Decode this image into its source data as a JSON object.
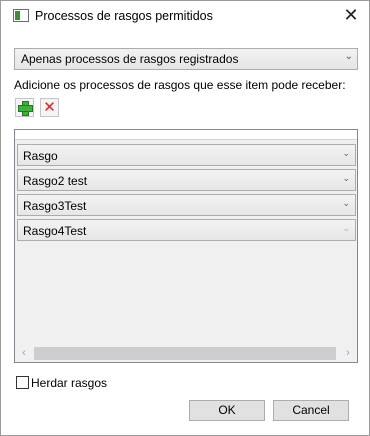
{
  "dialog": {
    "title": "Processos de rasgos permitidos",
    "close_glyph": "✕"
  },
  "mode_select": {
    "selected": "Apenas processos de rasgos registrados"
  },
  "instruction": "Adicione os processos de rasgos que esse item pode receber:",
  "toolbar": {
    "add_icon": "green-plus-icon",
    "remove_icon": "red-x-icon",
    "remove_glyph": "✕"
  },
  "processes": [
    {
      "value": "Rasgo"
    },
    {
      "value": "Rasgo2 test"
    },
    {
      "value": "Rasgo3Test"
    },
    {
      "value": "Rasgo4Test"
    }
  ],
  "scrollbar": {
    "left_glyph": "‹",
    "right_glyph": "›"
  },
  "inherit": {
    "label": "Herdar rasgos",
    "checked": false
  },
  "buttons": {
    "ok": "OK",
    "cancel": "Cancel"
  },
  "colors": {
    "add_icon": "#3fb03f",
    "remove_icon": "#e02020"
  }
}
